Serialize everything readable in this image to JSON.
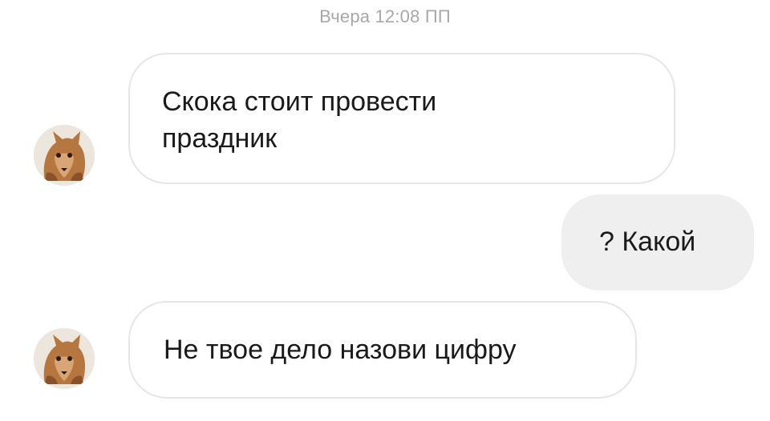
{
  "conversation": {
    "timestamp": "Вчера 12:08 ПП",
    "messages": [
      {
        "direction": "incoming",
        "text_line1": "Скока стоит провести",
        "text_line2": "праздник"
      },
      {
        "direction": "outgoing",
        "text": "? Какой"
      },
      {
        "direction": "incoming",
        "text": "Не твое дело назови цифру"
      }
    ]
  },
  "colors": {
    "incoming_bubble_bg": "#ffffff",
    "incoming_bubble_border": "#e6e6e6",
    "outgoing_bubble_bg": "#efefef",
    "timestamp_text": "#a8a8a8",
    "message_text": "#1a1a1a"
  },
  "icons": {
    "sender_avatar": "fox-mask-avatar-icon"
  }
}
